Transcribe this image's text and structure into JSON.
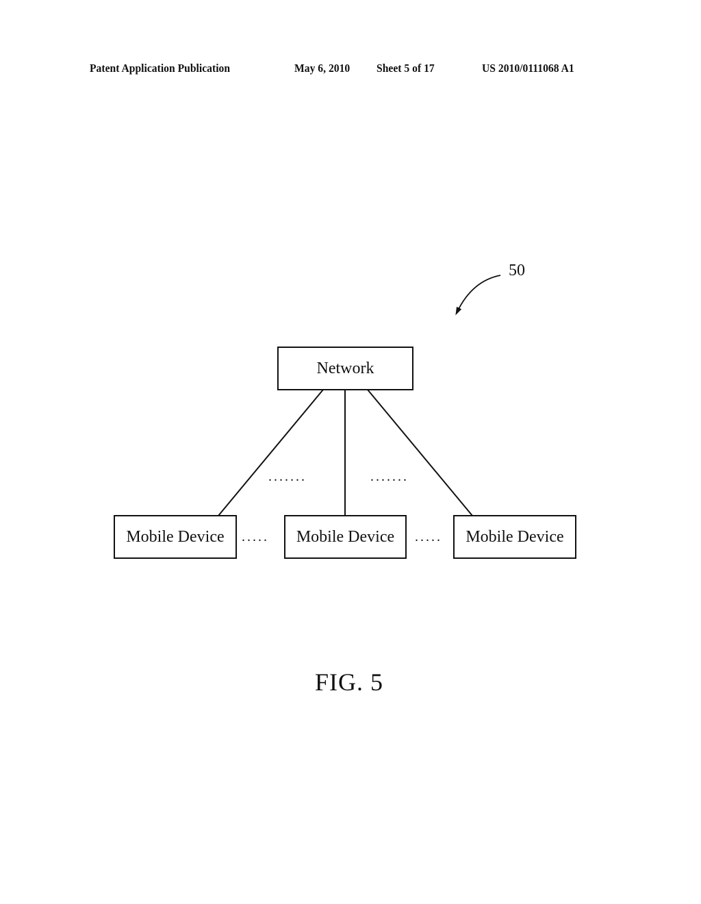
{
  "header": {
    "left": "Patent Application Publication",
    "date": "May 6, 2010",
    "sheet": "Sheet 5 of 17",
    "number": "US 2010/0111068 A1"
  },
  "figure": {
    "reference_numeral": "50",
    "caption": "FIG. 5",
    "network_label": "Network",
    "devices": [
      "Mobile Device",
      "Mobile Device",
      "Mobile Device"
    ],
    "ellipsis_upper": ".......",
    "ellipsis_lower": "....."
  }
}
